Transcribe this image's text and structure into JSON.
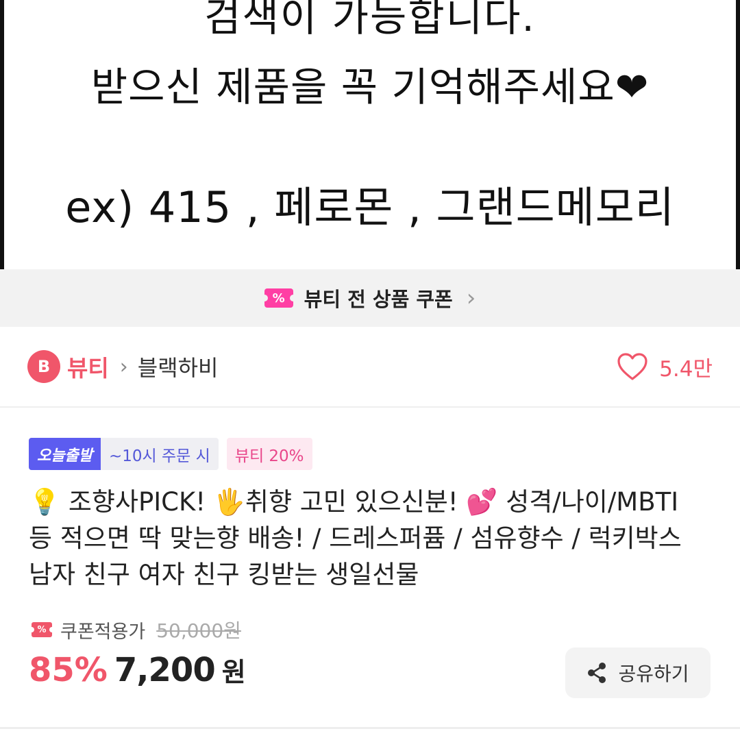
{
  "product_image": {
    "line1": "검색이 가능합니다.",
    "line2": "받으신 제품을 꼭 기억해주세요❤",
    "line3": "ex) 415 , 페로몬 , 그랜드메모리"
  },
  "coupon_banner": {
    "icon_text": "%",
    "label": "뷰티 전 상품 쿠폰",
    "chevron": "›"
  },
  "category": {
    "badge": "B",
    "main": "뷰티",
    "separator": "›",
    "sub": "블랙하비",
    "like_count": "5.4만"
  },
  "tags": {
    "today_shipping": "오늘출발",
    "cutoff": "~10시 주문 시",
    "beauty_discount": "뷰티 20%"
  },
  "title": {
    "line1": "💡 조향사PICK! 🖐취향 고민 있으신분! 💕 성격/나이/MBTI",
    "line2": "등 적으면 딱 맞는향 배송! / 드레스퍼퓸 / 섬유향수 / 럭키박스",
    "line3": "남자 친구 여자 친구 킹받는 생일선물"
  },
  "price": {
    "coupon_icon_text": "%",
    "coupon_label": "쿠폰적용가",
    "original": "50,000원",
    "discount_rate": "85%",
    "final": "7,200",
    "currency": "원"
  },
  "share": {
    "label": "공유하기"
  },
  "colors": {
    "accent": "#f0566a",
    "coupon_pink": "#ff3fa4",
    "tag_blue": "#5c5cf0"
  }
}
